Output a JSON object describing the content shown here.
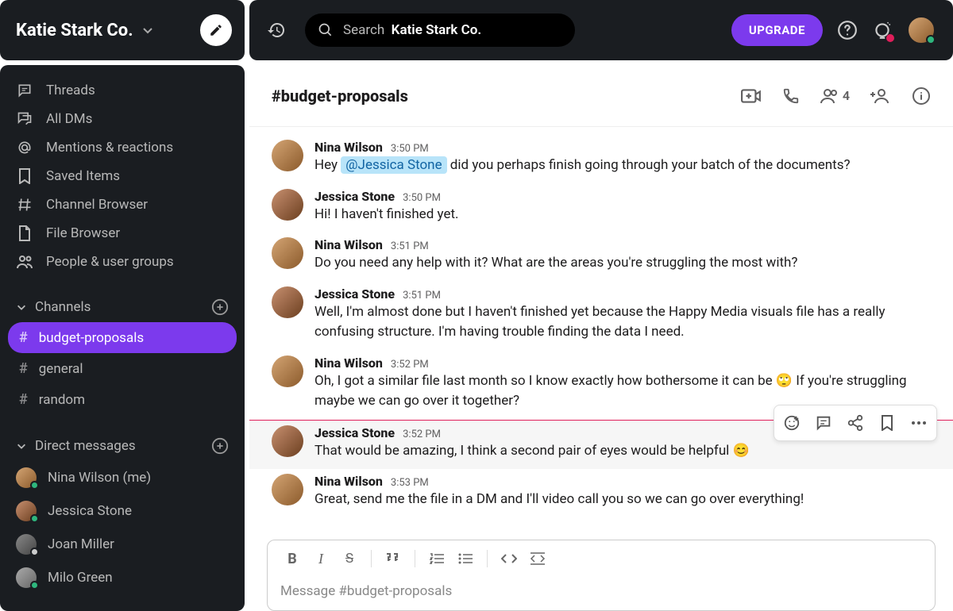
{
  "workspace": {
    "name": "Katie Stark Co."
  },
  "search": {
    "prefix": "Search",
    "scope": "Katie Stark Co."
  },
  "upgrade": "UPGRADE",
  "nav": [
    {
      "label": "Threads",
      "icon": "threads"
    },
    {
      "label": "All DMs",
      "icon": "dms"
    },
    {
      "label": "Mentions & reactions",
      "icon": "mentions"
    },
    {
      "label": "Saved Items",
      "icon": "bookmark"
    },
    {
      "label": "Channel Browser",
      "icon": "chanbrowser"
    },
    {
      "label": "File Browser",
      "icon": "filebrowser"
    },
    {
      "label": "People & user groups",
      "icon": "people"
    }
  ],
  "sections": {
    "channels": {
      "label": "Channels",
      "items": [
        {
          "name": "budget-proposals",
          "active": true
        },
        {
          "name": "general",
          "active": false
        },
        {
          "name": "random",
          "active": false
        }
      ]
    },
    "dms": {
      "label": "Direct messages",
      "items": [
        {
          "name": "Nina Wilson (me)",
          "presence": "#2eb67d",
          "av": "av-nina"
        },
        {
          "name": "Jessica Stone",
          "presence": "#2eb67d",
          "av": "av-jess"
        },
        {
          "name": "Joan Miller",
          "presence": "#ccc",
          "av": "av-joan"
        },
        {
          "name": "Milo Green",
          "presence": "#2eb67d",
          "av": "av-milo"
        }
      ]
    }
  },
  "channel": {
    "title": "#budget-proposals",
    "member_count": "4"
  },
  "messages": [
    {
      "author": "Nina Wilson",
      "time": "3:50 PM",
      "av": "av-nina",
      "pre": "Hey ",
      "mention": "@Jessica Stone",
      "post": " did you perhaps finish going through your batch of the documents?"
    },
    {
      "author": "Jessica Stone",
      "time": "3:50 PM",
      "av": "av-jess",
      "text": "Hi! I haven't finished yet."
    },
    {
      "author": "Nina Wilson",
      "time": "3:51 PM",
      "av": "av-nina",
      "text": "Do you need any help with it? What are the areas you're struggling the most with?"
    },
    {
      "author": "Jessica Stone",
      "time": "3:51 PM",
      "av": "av-jess",
      "text": "Well, I'm almost done but I haven't finished yet because the Happy Media visuals file has a really confusing structure. I'm having trouble finding the data I need."
    },
    {
      "author": "Nina Wilson",
      "time": "3:52 PM",
      "av": "av-nina",
      "text": "Oh, I got a similar file last month so I know exactly how bothersome it can be 🙄 If you're struggling maybe we can go over it together?"
    },
    {
      "author": "Jessica Stone",
      "time": "3:52 PM",
      "av": "av-jess",
      "text": "That would be amazing, I think a second pair of eyes would be helpful 😊",
      "highlight": true
    },
    {
      "author": "Nina Wilson",
      "time": "3:53 PM",
      "av": "av-nina",
      "text": "Great, send me the file in a DM and I'll video call you so we can go over everything!"
    }
  ],
  "composer": {
    "placeholder": "Message #budget-proposals"
  }
}
